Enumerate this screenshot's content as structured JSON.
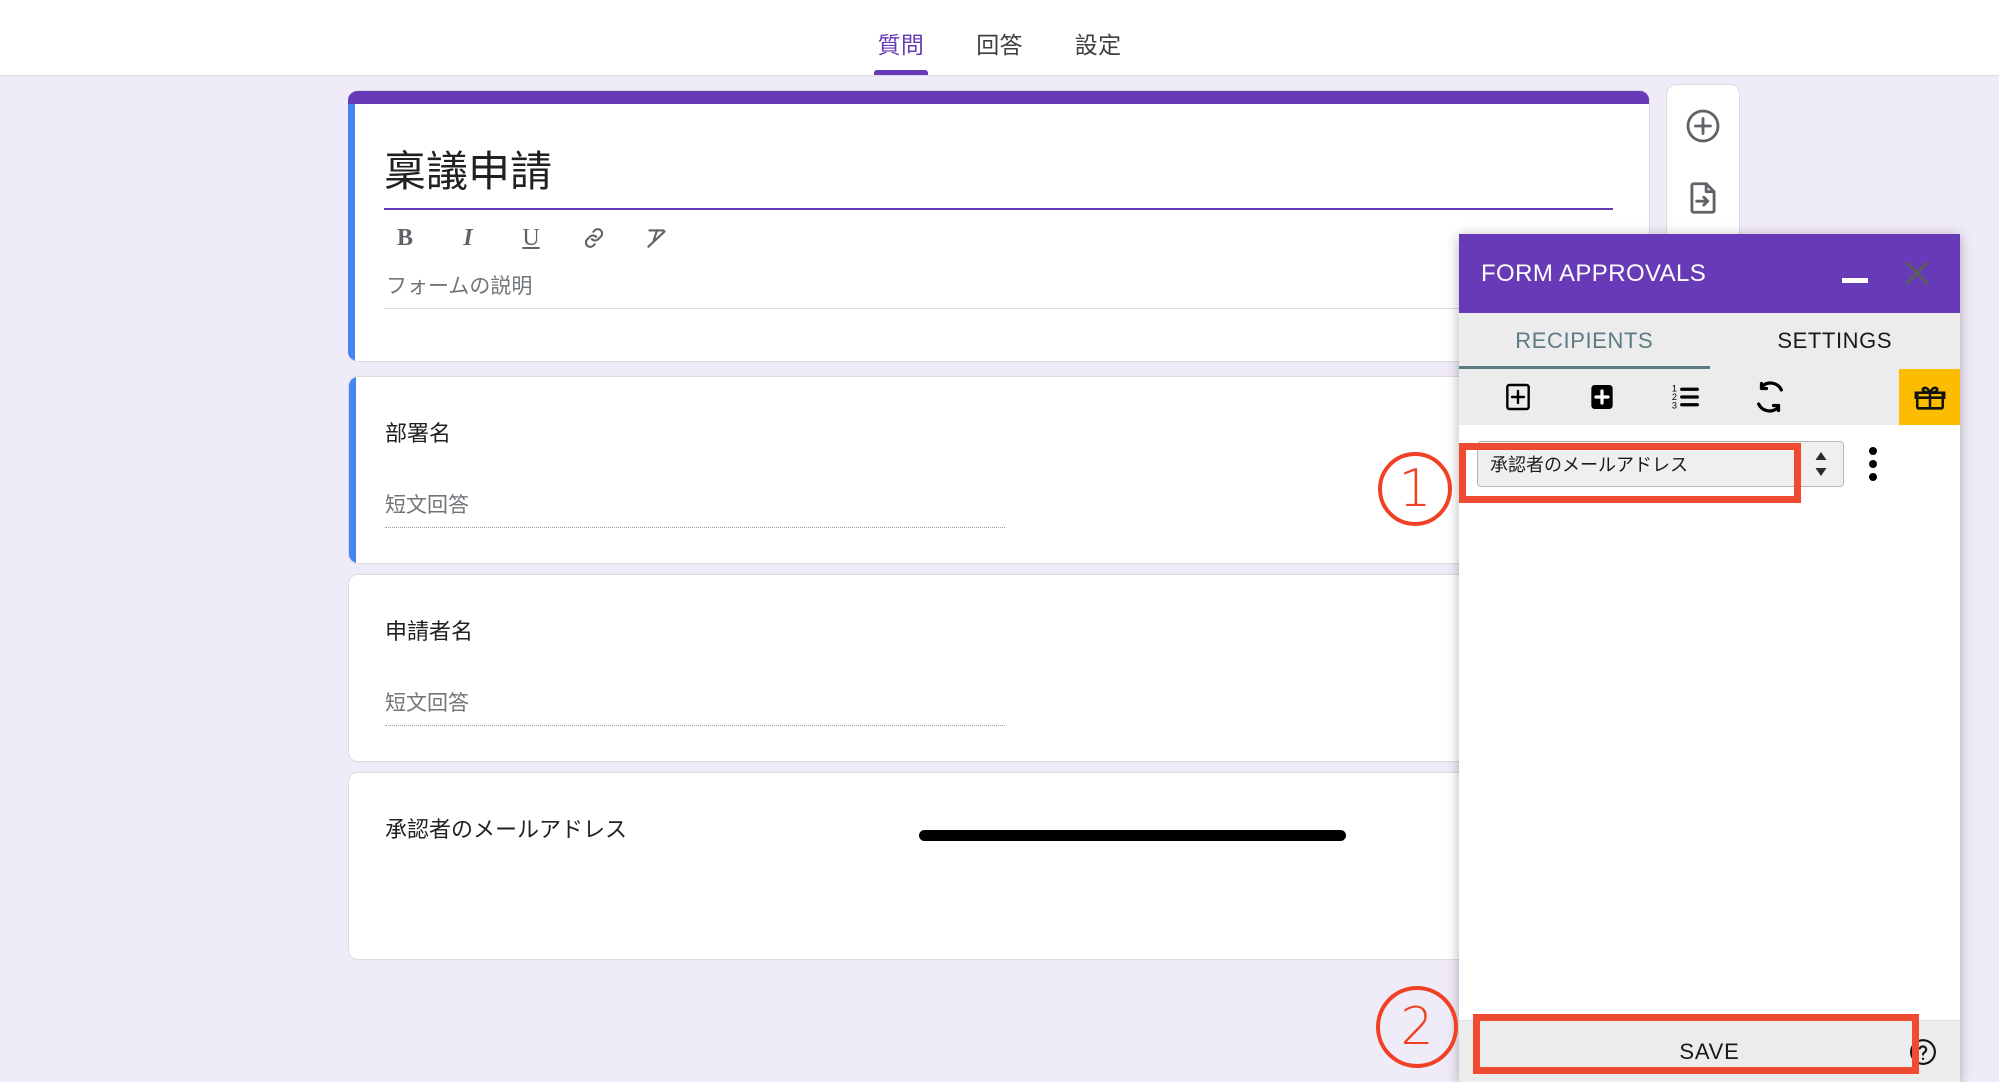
{
  "colors": {
    "brand_purple": "#673ab7",
    "canvas_bg": "#f0ebf8",
    "selected_blue": "#4285f4",
    "annotation_red": "#f04124",
    "gift_yellow": "#fcbd00",
    "addon_tab_active": "#5b7b83"
  },
  "topbar": {
    "tabs": [
      {
        "label": "質問",
        "active": true
      },
      {
        "label": "回答",
        "active": false
      },
      {
        "label": "設定",
        "active": false
      }
    ]
  },
  "form": {
    "title": "稟議申請",
    "description_placeholder": "フォームの説明",
    "rtf_toolbar": [
      {
        "name": "bold-icon",
        "glyph": "B"
      },
      {
        "name": "italic-icon",
        "glyph": "I"
      },
      {
        "name": "underline-icon",
        "glyph": "U"
      },
      {
        "name": "link-icon",
        "glyph": "link"
      },
      {
        "name": "clear-formatting-icon",
        "glyph": "clear"
      }
    ],
    "questions": [
      {
        "title": "部署名",
        "answer_placeholder": "短文回答",
        "selected": true
      },
      {
        "title": "申請者名",
        "answer_placeholder": "短文回答",
        "selected": false
      },
      {
        "title": "承認者のメールアドレス",
        "answer_placeholder": "",
        "selected": false
      }
    ]
  },
  "side_toolbar": {
    "buttons": [
      {
        "name": "add-question-icon",
        "label": "質問を追加"
      },
      {
        "name": "import-questions-icon",
        "label": "質問をインポート"
      }
    ]
  },
  "addon": {
    "title": "FORM APPROVALS",
    "minimize_label": "",
    "close_label": "",
    "tabs": [
      {
        "label": "RECIPIENTS",
        "active": true
      },
      {
        "label": "SETTINGS",
        "active": false
      }
    ],
    "toolbar": [
      {
        "name": "add-box-outline-icon"
      },
      {
        "name": "add-box-filled-icon"
      },
      {
        "name": "numbered-list-icon"
      },
      {
        "name": "refresh-icon"
      },
      {
        "name": "gift-icon"
      }
    ],
    "recipient": {
      "selected_option": "承認者のメールアドレス",
      "options": [
        "承認者のメールアドレス"
      ],
      "kebab_label": ""
    },
    "footer": {
      "save_label": "SAVE",
      "help_label": "?"
    }
  },
  "annotations": [
    {
      "name": "step-1-marker",
      "label": "1"
    },
    {
      "name": "step-2-marker",
      "label": "2"
    }
  ]
}
